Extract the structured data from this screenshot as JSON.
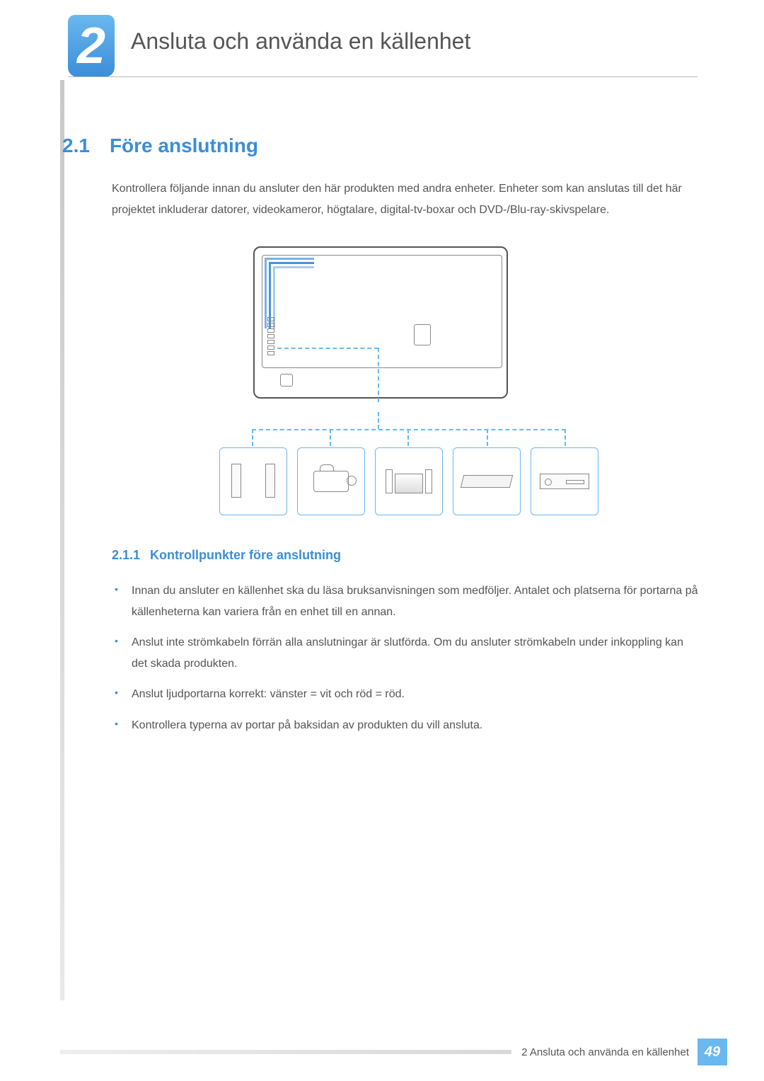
{
  "chapter": {
    "number": "2",
    "title": "Ansluta och använda en källenhet"
  },
  "section": {
    "number": "2.1",
    "title": "Före anslutning"
  },
  "intro_paragraph": "Kontrollera följande innan du ansluter den här produkten med andra enheter. Enheter som kan anslutas till det här projektet inkluderar datorer, videokameror, högtalare, digital-tv-boxar och DVD-/Blu-ray-skivspelare.",
  "subsection": {
    "number": "2.1.1",
    "title": "Kontrollpunkter före anslutning"
  },
  "bullets": [
    "Innan du ansluter en källenhet ska du läsa bruksanvisningen som medföljer. Antalet och platserna för portarna på källenheterna kan variera från en enhet till en annan.",
    "Anslut inte strömkabeln förrän alla anslutningar är slutförda. Om du ansluter strömkabeln under inkoppling kan det skada produkten.",
    "Anslut ljudportarna korrekt: vänster = vit och röd = röd.",
    "Kontrollera typerna av portar på baksidan av produkten du vill ansluta."
  ],
  "footer": {
    "text": "2 Ansluta och använda en källenhet",
    "page_number": "49"
  },
  "devices": [
    "speakers",
    "camcorder",
    "stereo",
    "settop",
    "player"
  ]
}
